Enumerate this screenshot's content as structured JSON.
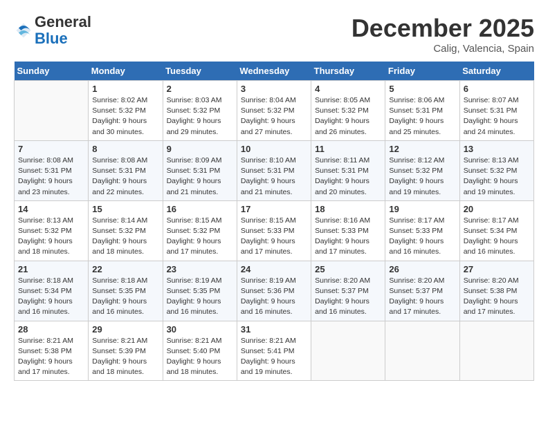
{
  "header": {
    "logo_general": "General",
    "logo_blue": "Blue",
    "month": "December 2025",
    "location": "Calig, Valencia, Spain"
  },
  "days_of_week": [
    "Sunday",
    "Monday",
    "Tuesday",
    "Wednesday",
    "Thursday",
    "Friday",
    "Saturday"
  ],
  "weeks": [
    [
      {
        "day": "",
        "sunrise": "",
        "sunset": "",
        "daylight": ""
      },
      {
        "day": "1",
        "sunrise": "Sunrise: 8:02 AM",
        "sunset": "Sunset: 5:32 PM",
        "daylight": "Daylight: 9 hours and 30 minutes."
      },
      {
        "day": "2",
        "sunrise": "Sunrise: 8:03 AM",
        "sunset": "Sunset: 5:32 PM",
        "daylight": "Daylight: 9 hours and 29 minutes."
      },
      {
        "day": "3",
        "sunrise": "Sunrise: 8:04 AM",
        "sunset": "Sunset: 5:32 PM",
        "daylight": "Daylight: 9 hours and 27 minutes."
      },
      {
        "day": "4",
        "sunrise": "Sunrise: 8:05 AM",
        "sunset": "Sunset: 5:32 PM",
        "daylight": "Daylight: 9 hours and 26 minutes."
      },
      {
        "day": "5",
        "sunrise": "Sunrise: 8:06 AM",
        "sunset": "Sunset: 5:31 PM",
        "daylight": "Daylight: 9 hours and 25 minutes."
      },
      {
        "day": "6",
        "sunrise": "Sunrise: 8:07 AM",
        "sunset": "Sunset: 5:31 PM",
        "daylight": "Daylight: 9 hours and 24 minutes."
      }
    ],
    [
      {
        "day": "7",
        "sunrise": "Sunrise: 8:08 AM",
        "sunset": "Sunset: 5:31 PM",
        "daylight": "Daylight: 9 hours and 23 minutes."
      },
      {
        "day": "8",
        "sunrise": "Sunrise: 8:08 AM",
        "sunset": "Sunset: 5:31 PM",
        "daylight": "Daylight: 9 hours and 22 minutes."
      },
      {
        "day": "9",
        "sunrise": "Sunrise: 8:09 AM",
        "sunset": "Sunset: 5:31 PM",
        "daylight": "Daylight: 9 hours and 21 minutes."
      },
      {
        "day": "10",
        "sunrise": "Sunrise: 8:10 AM",
        "sunset": "Sunset: 5:31 PM",
        "daylight": "Daylight: 9 hours and 21 minutes."
      },
      {
        "day": "11",
        "sunrise": "Sunrise: 8:11 AM",
        "sunset": "Sunset: 5:31 PM",
        "daylight": "Daylight: 9 hours and 20 minutes."
      },
      {
        "day": "12",
        "sunrise": "Sunrise: 8:12 AM",
        "sunset": "Sunset: 5:32 PM",
        "daylight": "Daylight: 9 hours and 19 minutes."
      },
      {
        "day": "13",
        "sunrise": "Sunrise: 8:13 AM",
        "sunset": "Sunset: 5:32 PM",
        "daylight": "Daylight: 9 hours and 19 minutes."
      }
    ],
    [
      {
        "day": "14",
        "sunrise": "Sunrise: 8:13 AM",
        "sunset": "Sunset: 5:32 PM",
        "daylight": "Daylight: 9 hours and 18 minutes."
      },
      {
        "day": "15",
        "sunrise": "Sunrise: 8:14 AM",
        "sunset": "Sunset: 5:32 PM",
        "daylight": "Daylight: 9 hours and 18 minutes."
      },
      {
        "day": "16",
        "sunrise": "Sunrise: 8:15 AM",
        "sunset": "Sunset: 5:32 PM",
        "daylight": "Daylight: 9 hours and 17 minutes."
      },
      {
        "day": "17",
        "sunrise": "Sunrise: 8:15 AM",
        "sunset": "Sunset: 5:33 PM",
        "daylight": "Daylight: 9 hours and 17 minutes."
      },
      {
        "day": "18",
        "sunrise": "Sunrise: 8:16 AM",
        "sunset": "Sunset: 5:33 PM",
        "daylight": "Daylight: 9 hours and 17 minutes."
      },
      {
        "day": "19",
        "sunrise": "Sunrise: 8:17 AM",
        "sunset": "Sunset: 5:33 PM",
        "daylight": "Daylight: 9 hours and 16 minutes."
      },
      {
        "day": "20",
        "sunrise": "Sunrise: 8:17 AM",
        "sunset": "Sunset: 5:34 PM",
        "daylight": "Daylight: 9 hours and 16 minutes."
      }
    ],
    [
      {
        "day": "21",
        "sunrise": "Sunrise: 8:18 AM",
        "sunset": "Sunset: 5:34 PM",
        "daylight": "Daylight: 9 hours and 16 minutes."
      },
      {
        "day": "22",
        "sunrise": "Sunrise: 8:18 AM",
        "sunset": "Sunset: 5:35 PM",
        "daylight": "Daylight: 9 hours and 16 minutes."
      },
      {
        "day": "23",
        "sunrise": "Sunrise: 8:19 AM",
        "sunset": "Sunset: 5:35 PM",
        "daylight": "Daylight: 9 hours and 16 minutes."
      },
      {
        "day": "24",
        "sunrise": "Sunrise: 8:19 AM",
        "sunset": "Sunset: 5:36 PM",
        "daylight": "Daylight: 9 hours and 16 minutes."
      },
      {
        "day": "25",
        "sunrise": "Sunrise: 8:20 AM",
        "sunset": "Sunset: 5:37 PM",
        "daylight": "Daylight: 9 hours and 16 minutes."
      },
      {
        "day": "26",
        "sunrise": "Sunrise: 8:20 AM",
        "sunset": "Sunset: 5:37 PM",
        "daylight": "Daylight: 9 hours and 17 minutes."
      },
      {
        "day": "27",
        "sunrise": "Sunrise: 8:20 AM",
        "sunset": "Sunset: 5:38 PM",
        "daylight": "Daylight: 9 hours and 17 minutes."
      }
    ],
    [
      {
        "day": "28",
        "sunrise": "Sunrise: 8:21 AM",
        "sunset": "Sunset: 5:38 PM",
        "daylight": "Daylight: 9 hours and 17 minutes."
      },
      {
        "day": "29",
        "sunrise": "Sunrise: 8:21 AM",
        "sunset": "Sunset: 5:39 PM",
        "daylight": "Daylight: 9 hours and 18 minutes."
      },
      {
        "day": "30",
        "sunrise": "Sunrise: 8:21 AM",
        "sunset": "Sunset: 5:40 PM",
        "daylight": "Daylight: 9 hours and 18 minutes."
      },
      {
        "day": "31",
        "sunrise": "Sunrise: 8:21 AM",
        "sunset": "Sunset: 5:41 PM",
        "daylight": "Daylight: 9 hours and 19 minutes."
      },
      {
        "day": "",
        "sunrise": "",
        "sunset": "",
        "daylight": ""
      },
      {
        "day": "",
        "sunrise": "",
        "sunset": "",
        "daylight": ""
      },
      {
        "day": "",
        "sunrise": "",
        "sunset": "",
        "daylight": ""
      }
    ]
  ]
}
